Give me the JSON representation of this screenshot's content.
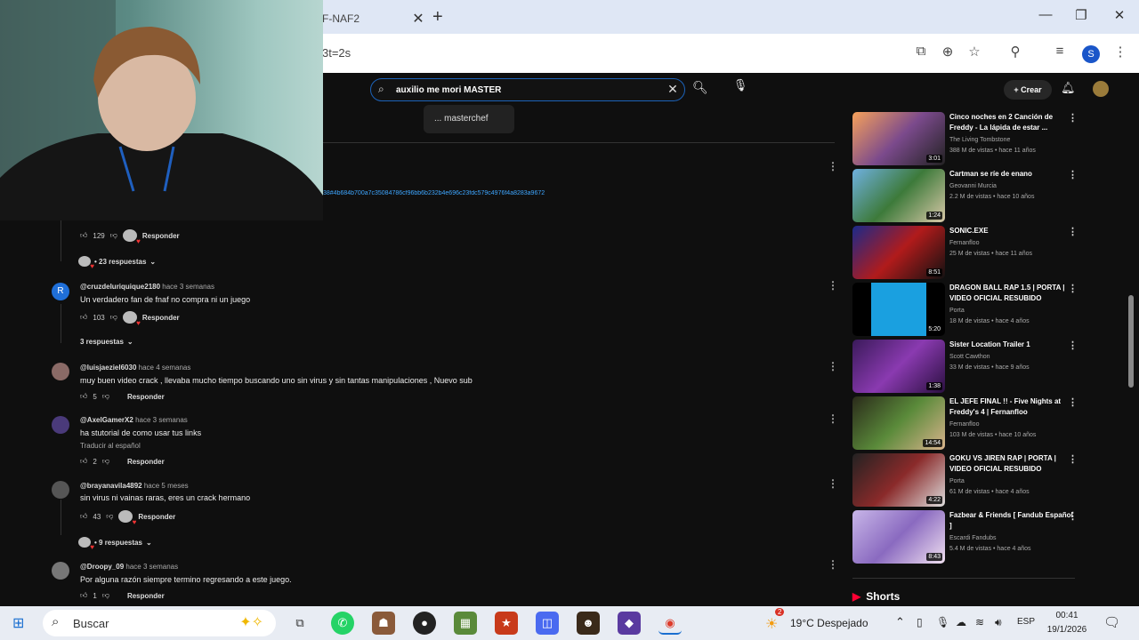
{
  "browser": {
    "tab_title": "F-NAF2",
    "url_fragment": "3t=2s",
    "profile_initial": "S"
  },
  "youtube": {
    "search_value": "auxilio me mori MASTER",
    "suggestion": "... masterchef",
    "create_label": "Crear",
    "description_link": "38#4b684b700a7c35084786cf96bb6b232b4e696c23fdc579c4976f4a8283a9672",
    "comments": [
      {
        "handle": "",
        "time": "",
        "text": "",
        "likes": "129",
        "reply": "Responder"
      },
      {
        "handle": "@cruzdeluriquique2180",
        "time": "hace 3 semanas",
        "text": "Un verdadero fan de fnaf no compra ni un juego",
        "likes": "103",
        "reply": "Responder"
      },
      {
        "handle": "@luisjaeziel6030",
        "time": "hace 4 semanas",
        "text": "muy buen video crack , llevaba mucho tiempo buscando uno sin virus y sin tantas manipulaciones , Nuevo sub",
        "likes": "5",
        "reply": "Responder"
      },
      {
        "handle": "@AxelGamerX2",
        "time": "hace 3 semanas",
        "text": "ha stutorial de como usar tus links",
        "translate": "Traducir al español",
        "likes": "2",
        "reply": "Responder"
      },
      {
        "handle": "@brayanavila4892",
        "time": "hace 5 meses",
        "text": "sin virus ni vainas raras, eres un crack hermano",
        "likes": "43",
        "reply": "Responder"
      },
      {
        "handle": "@Droopy_09",
        "time": "hace 3 semanas",
        "text": "Por alguna razón siempre termino regresando a este juego.",
        "likes": "1",
        "reply": "Responder"
      }
    ],
    "replies": {
      "r1": "• 23 respuestas",
      "r2": "3 respuestas",
      "r3": "• 9 respuestas"
    },
    "sidebar": [
      {
        "title": "Cinco noches en 2 Canción de Freddy - La lápida de estar ...",
        "channel": "The Living Tombstone",
        "stats": "388 M de vistas • hace 11 años",
        "duration": "3:01"
      },
      {
        "title": "Cartman se ríe de enano",
        "channel": "Geovanni Murcia",
        "stats": "2.2 M de vistas • hace 10 años",
        "duration": "1:24"
      },
      {
        "title": "SONIC.EXE",
        "channel": "Fernanfloo",
        "stats": "25 M de vistas • hace 11 años",
        "duration": "8:51"
      },
      {
        "title": "DRAGON BALL RAP 1.5 | PORTA | VIDEO OFICIAL RESUBIDO",
        "channel": "Porta",
        "stats": "18 M de vistas • hace 4 años",
        "duration": "5:20"
      },
      {
        "title": "Sister Location Trailer 1",
        "channel": "Scott Cawthon",
        "stats": "33 M de vistas • hace 9 años",
        "duration": "1:38"
      },
      {
        "title": "EL JEFE FINAL !! - Five Nights at Freddy's 4 | Fernanfloo",
        "channel": "Fernanfloo",
        "stats": "103 M de vistas • hace 10 años",
        "duration": "14:54"
      },
      {
        "title": "GOKU VS JIREN RAP | PORTA | VIDEO OFICIAL RESUBIDO",
        "channel": "Porta",
        "stats": "61 M de vistas • hace 4 años",
        "duration": "4:22"
      },
      {
        "title": "Fazbear & Friends [ Fandub Español ]",
        "channel": "Escardi Fandubs",
        "stats": "5.4 M de vistas • hace 4 años",
        "duration": "8:43"
      }
    ],
    "shorts_label": "Shorts"
  },
  "taskbar": {
    "search_label": "Buscar",
    "weather": "19°C  Despejado",
    "language": "ESP",
    "time": "00:41",
    "date": "19/1/2026",
    "weather_badge": "2"
  },
  "colors": {
    "yt_bg": "#0f0f0f",
    "link": "#3ea6ff",
    "search_border": "#1c62b9"
  }
}
